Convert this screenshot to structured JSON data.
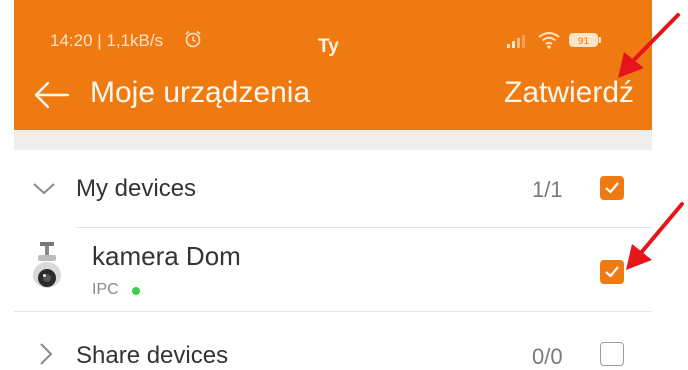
{
  "status_bar": {
    "time_speed": "14:20 | 1,1kB/s",
    "carrier": "Ty",
    "battery": "91"
  },
  "app_bar": {
    "title": "Moje urządzenia",
    "confirm_label": "Zatwierdź"
  },
  "groups": [
    {
      "label": "My devices",
      "count": "1/1",
      "checked": true,
      "expanded": true
    },
    {
      "label": "Share devices",
      "count": "0/0",
      "checked": false,
      "expanded": false
    }
  ],
  "devices": [
    {
      "name": "kamera Dom",
      "type": "IPC",
      "online": true,
      "checked": true
    }
  ],
  "colors": {
    "accent": "#f07a12",
    "online": "#3ccc45",
    "annotation_arrow": "#e8141c"
  }
}
